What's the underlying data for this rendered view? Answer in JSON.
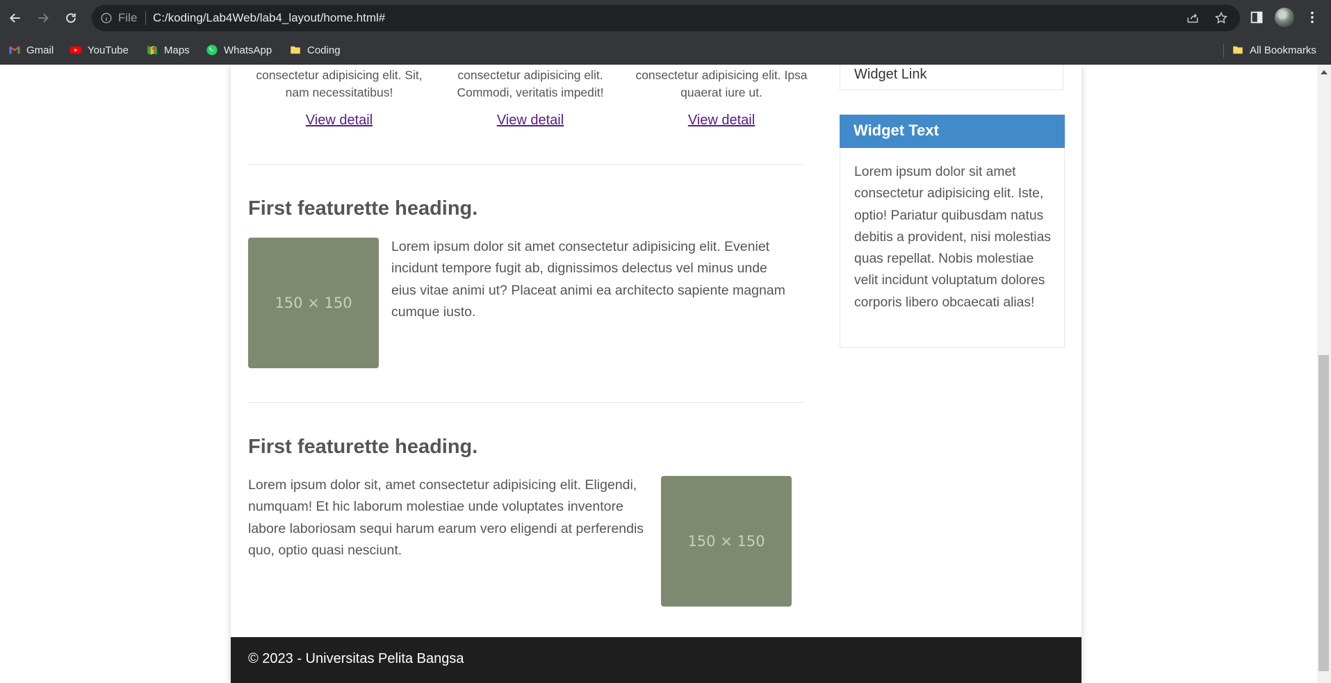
{
  "browser": {
    "site_info_label": "File",
    "url": "C:/koding/Lab4Web/lab4_layout/home.html#",
    "bookmarks": [
      {
        "label": "Gmail",
        "icon": "gmail-icon"
      },
      {
        "label": "YouTube",
        "icon": "youtube-icon"
      },
      {
        "label": "Maps",
        "icon": "maps-icon"
      },
      {
        "label": "WhatsApp",
        "icon": "whatsapp-icon"
      },
      {
        "label": "Coding",
        "icon": "folder-icon"
      }
    ],
    "all_bookmarks_label": "All Bookmarks"
  },
  "thumbnails": [
    {
      "text_line1": "consectetur adipisicing elit. Sit,",
      "text_line2": "nam necessitatibus!",
      "link": "View detail"
    },
    {
      "text_line1": "consectetur adipisicing elit.",
      "text_line2": "Commodi, veritatis impedit!",
      "link": "View detail"
    },
    {
      "text_line1": "consectetur adipisicing elit. Ipsa",
      "text_line2": "quaerat iure ut.",
      "link": "View detail"
    }
  ],
  "featurettes": [
    {
      "heading": "First featurette heading.",
      "image_label": "150 × 150",
      "text": "Lorem ipsum dolor sit amet consectetur adipisicing elit. Eveniet incidunt tempore fugit ab, dignissimos delectus vel minus unde eius vitae animi ut? Placeat animi ea architecto sapiente magnam cumque iusto."
    },
    {
      "heading": "First featurette heading.",
      "image_label": "150 × 150",
      "text": "Lorem ipsum dolor sit, amet consectetur adipisicing elit. Eligendi, numquam! Et hic laborum molestiae unde voluptates inventore labore laboriosam sequi harum earum vero eligendi at perferendis quo, optio quasi nesciunt."
    }
  ],
  "sidebar": {
    "widget_link": "Widget Link",
    "widget_text_title": "Widget Text",
    "widget_text_body": "Lorem ipsum dolor sit amet consectetur adipisicing elit. Iste, optio! Pariatur quibusdam natus debitis a provident, nisi molestias quas repellat. Nobis molestiae velit incidunt voluptatum dolores corporis libero obcaecati alias!"
  },
  "footer": {
    "text": "© 2023 - Universitas Pelita Bangsa"
  },
  "colors": {
    "widget_header": "#428bca",
    "placeholder": "#7e8a70",
    "footer_bg": "#1f1f1f",
    "link": "#551a8b"
  }
}
